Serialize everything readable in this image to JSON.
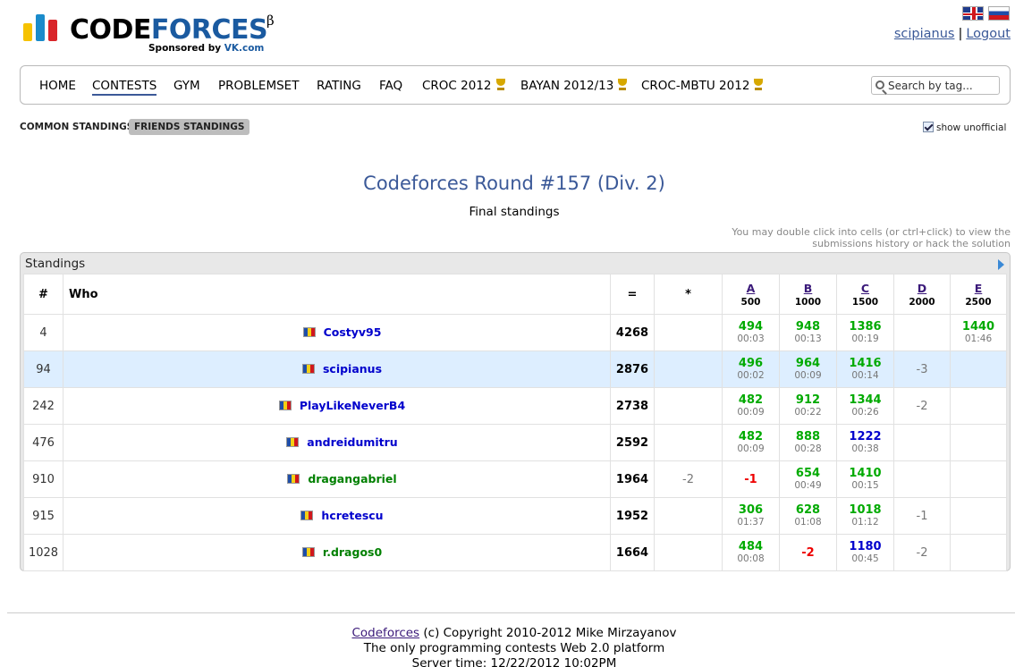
{
  "header": {
    "logo_text_black": "CODE",
    "logo_text_blue": "FORCES",
    "logo_beta": "β",
    "sponsor_prefix": "Sponsored by ",
    "sponsor_brand": "VK.com",
    "username": "scipianus",
    "separator": "|",
    "logout": "Logout"
  },
  "menu": {
    "items": [
      "HOME",
      "CONTESTS",
      "GYM",
      "PROBLEMSET",
      "RATING",
      "FAQ",
      "CROC 2012",
      "BAYAN 2012/13",
      "CROC-MBTU 2012"
    ],
    "active": "CONTESTS",
    "search_placeholder": "Search by tag..."
  },
  "subnav": {
    "common": "COMMON STANDINGS",
    "friends": "FRIENDS STANDINGS",
    "show_unofficial": "show unofficial"
  },
  "contest": {
    "title": "Codeforces Round #157 (Div. 2)",
    "subtitle": "Final standings",
    "hint_line1": "You may double click into cells (or ctrl+click) to view the",
    "hint_line2": "submissions history or hack the solution"
  },
  "standings": {
    "caption": "Standings",
    "columns": {
      "rank": "#",
      "who": "Who",
      "points": "=",
      "hacks": "*",
      "problems": [
        {
          "letter": "A",
          "score": "500"
        },
        {
          "letter": "B",
          "score": "1000"
        },
        {
          "letter": "C",
          "score": "1500"
        },
        {
          "letter": "D",
          "score": "2000"
        },
        {
          "letter": "E",
          "score": "2500"
        }
      ]
    },
    "rows": [
      {
        "rank": "4",
        "handle": "Costyv95",
        "color": "blue",
        "points": "4268",
        "hacks": "",
        "cells": [
          [
            "494",
            "00:03"
          ],
          [
            "948",
            "00:13"
          ],
          [
            "1386",
            "00:19"
          ],
          [
            "",
            ""
          ],
          [
            "1440",
            "01:46"
          ]
        ]
      },
      {
        "rank": "94",
        "handle": "scipianus",
        "color": "blue",
        "points": "2876",
        "hacks": "",
        "cells": [
          [
            "496",
            "00:02"
          ],
          [
            "964",
            "00:09"
          ],
          [
            "1416",
            "00:14"
          ],
          [
            "-3",
            ""
          ],
          [
            "",
            ""
          ]
        ]
      },
      {
        "rank": "242",
        "handle": "PlayLikeNeverB4",
        "color": "blue",
        "points": "2738",
        "hacks": "",
        "cells": [
          [
            "482",
            "00:09"
          ],
          [
            "912",
            "00:22"
          ],
          [
            "1344",
            "00:26"
          ],
          [
            "-2",
            ""
          ],
          [
            "",
            ""
          ]
        ]
      },
      {
        "rank": "476",
        "handle": "andreidumitru",
        "color": "blue",
        "points": "2592",
        "hacks": "",
        "cells": [
          [
            "482",
            "00:09"
          ],
          [
            "888",
            "00:28"
          ],
          [
            "1222",
            "00:38"
          ],
          [
            "",
            ""
          ],
          [
            "",
            ""
          ]
        ]
      },
      {
        "rank": "910",
        "handle": "dragangabriel",
        "color": "green",
        "points": "1964",
        "hacks": "-2",
        "cells": [
          [
            "-1",
            ""
          ],
          [
            "654",
            "00:49"
          ],
          [
            "1410",
            "00:15"
          ],
          [
            "",
            ""
          ],
          [
            "",
            ""
          ]
        ]
      },
      {
        "rank": "915",
        "handle": "hcretescu",
        "color": "blue",
        "points": "1952",
        "hacks": "",
        "cells": [
          [
            "306",
            "01:37"
          ],
          [
            "628",
            "01:08"
          ],
          [
            "1018",
            "01:12"
          ],
          [
            "-1",
            ""
          ],
          [
            "",
            ""
          ]
        ]
      },
      {
        "rank": "1028",
        "handle": "r.dragos0",
        "color": "green",
        "points": "1664",
        "hacks": "",
        "cells": [
          [
            "484",
            "00:08"
          ],
          [
            "-2",
            ""
          ],
          [
            "1180",
            "00:45"
          ],
          [
            "-2",
            ""
          ],
          [
            "",
            ""
          ]
        ]
      }
    ]
  },
  "footer": {
    "link": "Codeforces",
    "copyright": " (c) Copyright 2010-2012 Mike Mirzayanov",
    "line2": "The only programming contests Web 2.0 platform",
    "line3": "Server time: 12/22/2012 10:02PM"
  },
  "colors": {
    "accent": "#3b5998",
    "accepted": "#00aa00",
    "rejected": "#ee0000",
    "highlight_row": "#ddeeff"
  }
}
